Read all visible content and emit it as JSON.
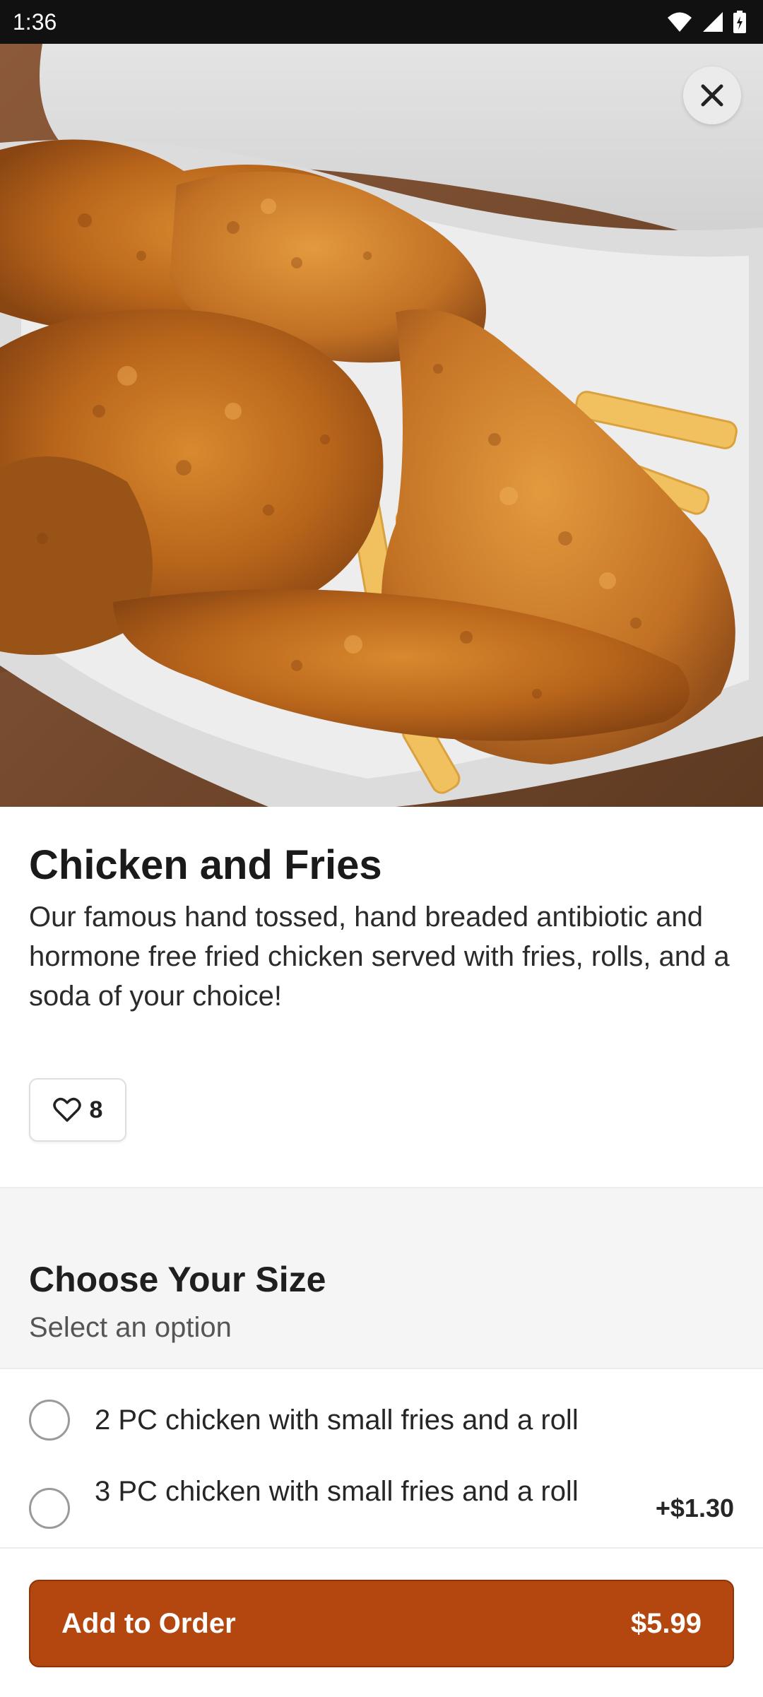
{
  "status_bar": {
    "time": "1:36"
  },
  "item": {
    "title": "Chicken and Fries",
    "description": "Our famous hand tossed, hand breaded antibiotic and hormone free fried chicken served with fries, rolls, and a soda of your choice!",
    "likes": "8"
  },
  "options_section": {
    "title": "Choose Your Size",
    "subtitle": "Select an option",
    "options": [
      {
        "label": "2 PC chicken with small fries and a roll",
        "price": ""
      },
      {
        "label": "3 PC chicken with small fries and a roll",
        "price": "+$1.30"
      }
    ]
  },
  "footer": {
    "add_label": "Add to Order",
    "price": "$5.99"
  },
  "colors": {
    "accent": "#b3470f",
    "accent_border": "#8e3407"
  },
  "icons": [
    "wifi-icon",
    "signal-icon",
    "battery-icon",
    "close-icon",
    "heart-icon"
  ]
}
